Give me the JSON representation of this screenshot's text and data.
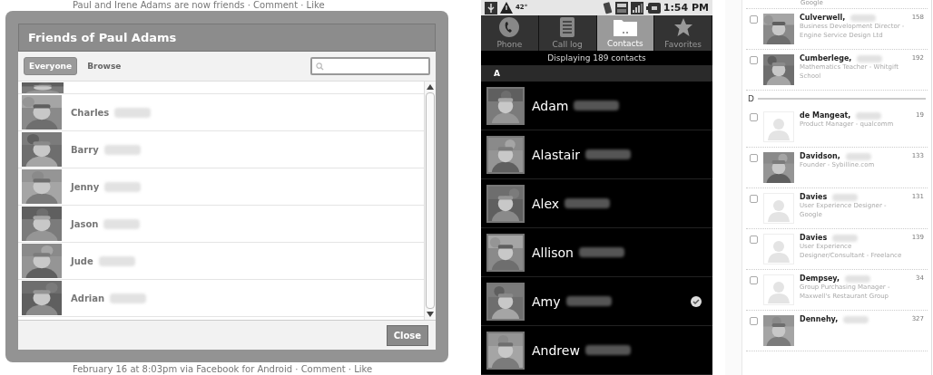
{
  "friends_dialog": {
    "feed_top": "Paul and Irene Adams are now friends · Comment · Like",
    "feed_bottom": "February 16 at 8:03pm via Facebook for Android · Comment · Like",
    "title": "Friends of Paul Adams",
    "tabs": [
      {
        "label": "Everyone",
        "selected": true
      },
      {
        "label": "Browse",
        "selected": false
      }
    ],
    "friends": [
      {
        "name": "Charles"
      },
      {
        "name": "Barry"
      },
      {
        "name": "Jenny"
      },
      {
        "name": "Jason"
      },
      {
        "name": "Jude"
      },
      {
        "name": "Adrian"
      }
    ],
    "close_button": "Close"
  },
  "phone_contacts": {
    "status_bar": {
      "temperature": "42°",
      "time": "1:54 PM"
    },
    "tabs": [
      {
        "label": "Phone",
        "selected": false
      },
      {
        "label": "Call log",
        "selected": false
      },
      {
        "label": "Contacts",
        "selected": true
      },
      {
        "label": "Favorites",
        "selected": false
      }
    ],
    "summary": "Displaying 189 contacts",
    "section": "A",
    "contacts": [
      {
        "name": "Adam",
        "presence": false
      },
      {
        "name": "Alastair",
        "presence": false
      },
      {
        "name": "Alex",
        "presence": false
      },
      {
        "name": "Allison",
        "presence": false
      },
      {
        "name": "Amy",
        "presence": true
      },
      {
        "name": "Andrew",
        "presence": false
      }
    ]
  },
  "contact_list": {
    "top_fragment": "Google",
    "items": [
      {
        "kind": "photo_contact",
        "name": "Culverwell,",
        "title": "Business Development Director - Engine Service Design Ltd",
        "count": "158",
        "checked": false
      },
      {
        "kind": "photo_contact",
        "name": "Cumberlege,",
        "title": "Mathematics Teacher - Whitgift School",
        "count": "192",
        "checked": false
      },
      {
        "kind": "section",
        "name": "D"
      },
      {
        "kind": "placeholder_contact",
        "name": "de Mangeat,",
        "title": "Product Manager - qualcomm",
        "count": "19",
        "checked": false
      },
      {
        "kind": "photo_contact",
        "name": "Davidson,",
        "title": "Founder - Sybilline.com",
        "count": "133",
        "checked": false
      },
      {
        "kind": "placeholder_contact",
        "name": "Davies",
        "title": "User Experience Designer - Google",
        "count": "131",
        "checked": false
      },
      {
        "kind": "placeholder_contact",
        "name": "Davies",
        "title": "User Experience Designer/Consultant - Freelance",
        "count": "139",
        "checked": false
      },
      {
        "kind": "placeholder_contact",
        "name": "Dempsey,",
        "title": "Group Purchasing Manager - Maxwell's Restaurant Group",
        "count": "34",
        "checked": false
      },
      {
        "kind": "photo_contact",
        "name": "Dennehy,",
        "count": "327",
        "checked": false
      }
    ]
  }
}
